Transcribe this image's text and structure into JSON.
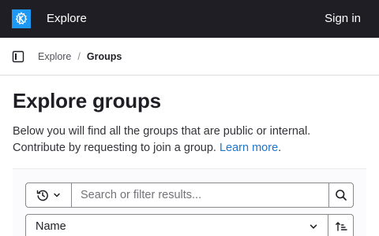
{
  "navbar": {
    "logo_icon": "kde-logo-icon",
    "explore_label": "Explore",
    "signin_label": "Sign in",
    "background": "#1f1e24"
  },
  "breadcrumb": {
    "items": [
      "Explore",
      "Groups"
    ],
    "separator": "/"
  },
  "page": {
    "title": "Explore groups",
    "description_text": "Below you will find all the groups that are public or internal. Contribute by requesting to join a group.",
    "learn_more_label": "Learn more",
    "description_end": "."
  },
  "filters": {
    "history_icon": "history-icon",
    "search_placeholder": "Search or filter results...",
    "search_icon": "search-icon",
    "sort_value": "Name",
    "sort_direction_icon": "sort-lowest-icon"
  },
  "colors": {
    "link": "#1f75cb",
    "brand": "#1d99f3"
  }
}
